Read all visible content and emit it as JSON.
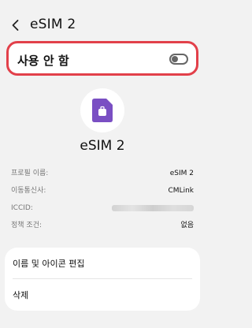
{
  "header": {
    "title": "eSIM 2",
    "back_icon": "chevron-left-icon"
  },
  "toggle": {
    "label": "사용 안 함",
    "state": "off",
    "highlight_color": "#e2404a"
  },
  "sim": {
    "icon": "sim-card-icon",
    "icon_color": "#7a4fc3",
    "name": "eSIM 2"
  },
  "info": [
    {
      "label": "프로필 이름:",
      "value": "eSIM 2"
    },
    {
      "label": "이동통신사:",
      "value": "CMLink"
    },
    {
      "label": "ICCID:",
      "value": ""
    },
    {
      "label": "정책 조건:",
      "value": "없음"
    }
  ],
  "menu": {
    "edit_label": "이름 및 아이콘 편집",
    "delete_label": "삭제"
  }
}
